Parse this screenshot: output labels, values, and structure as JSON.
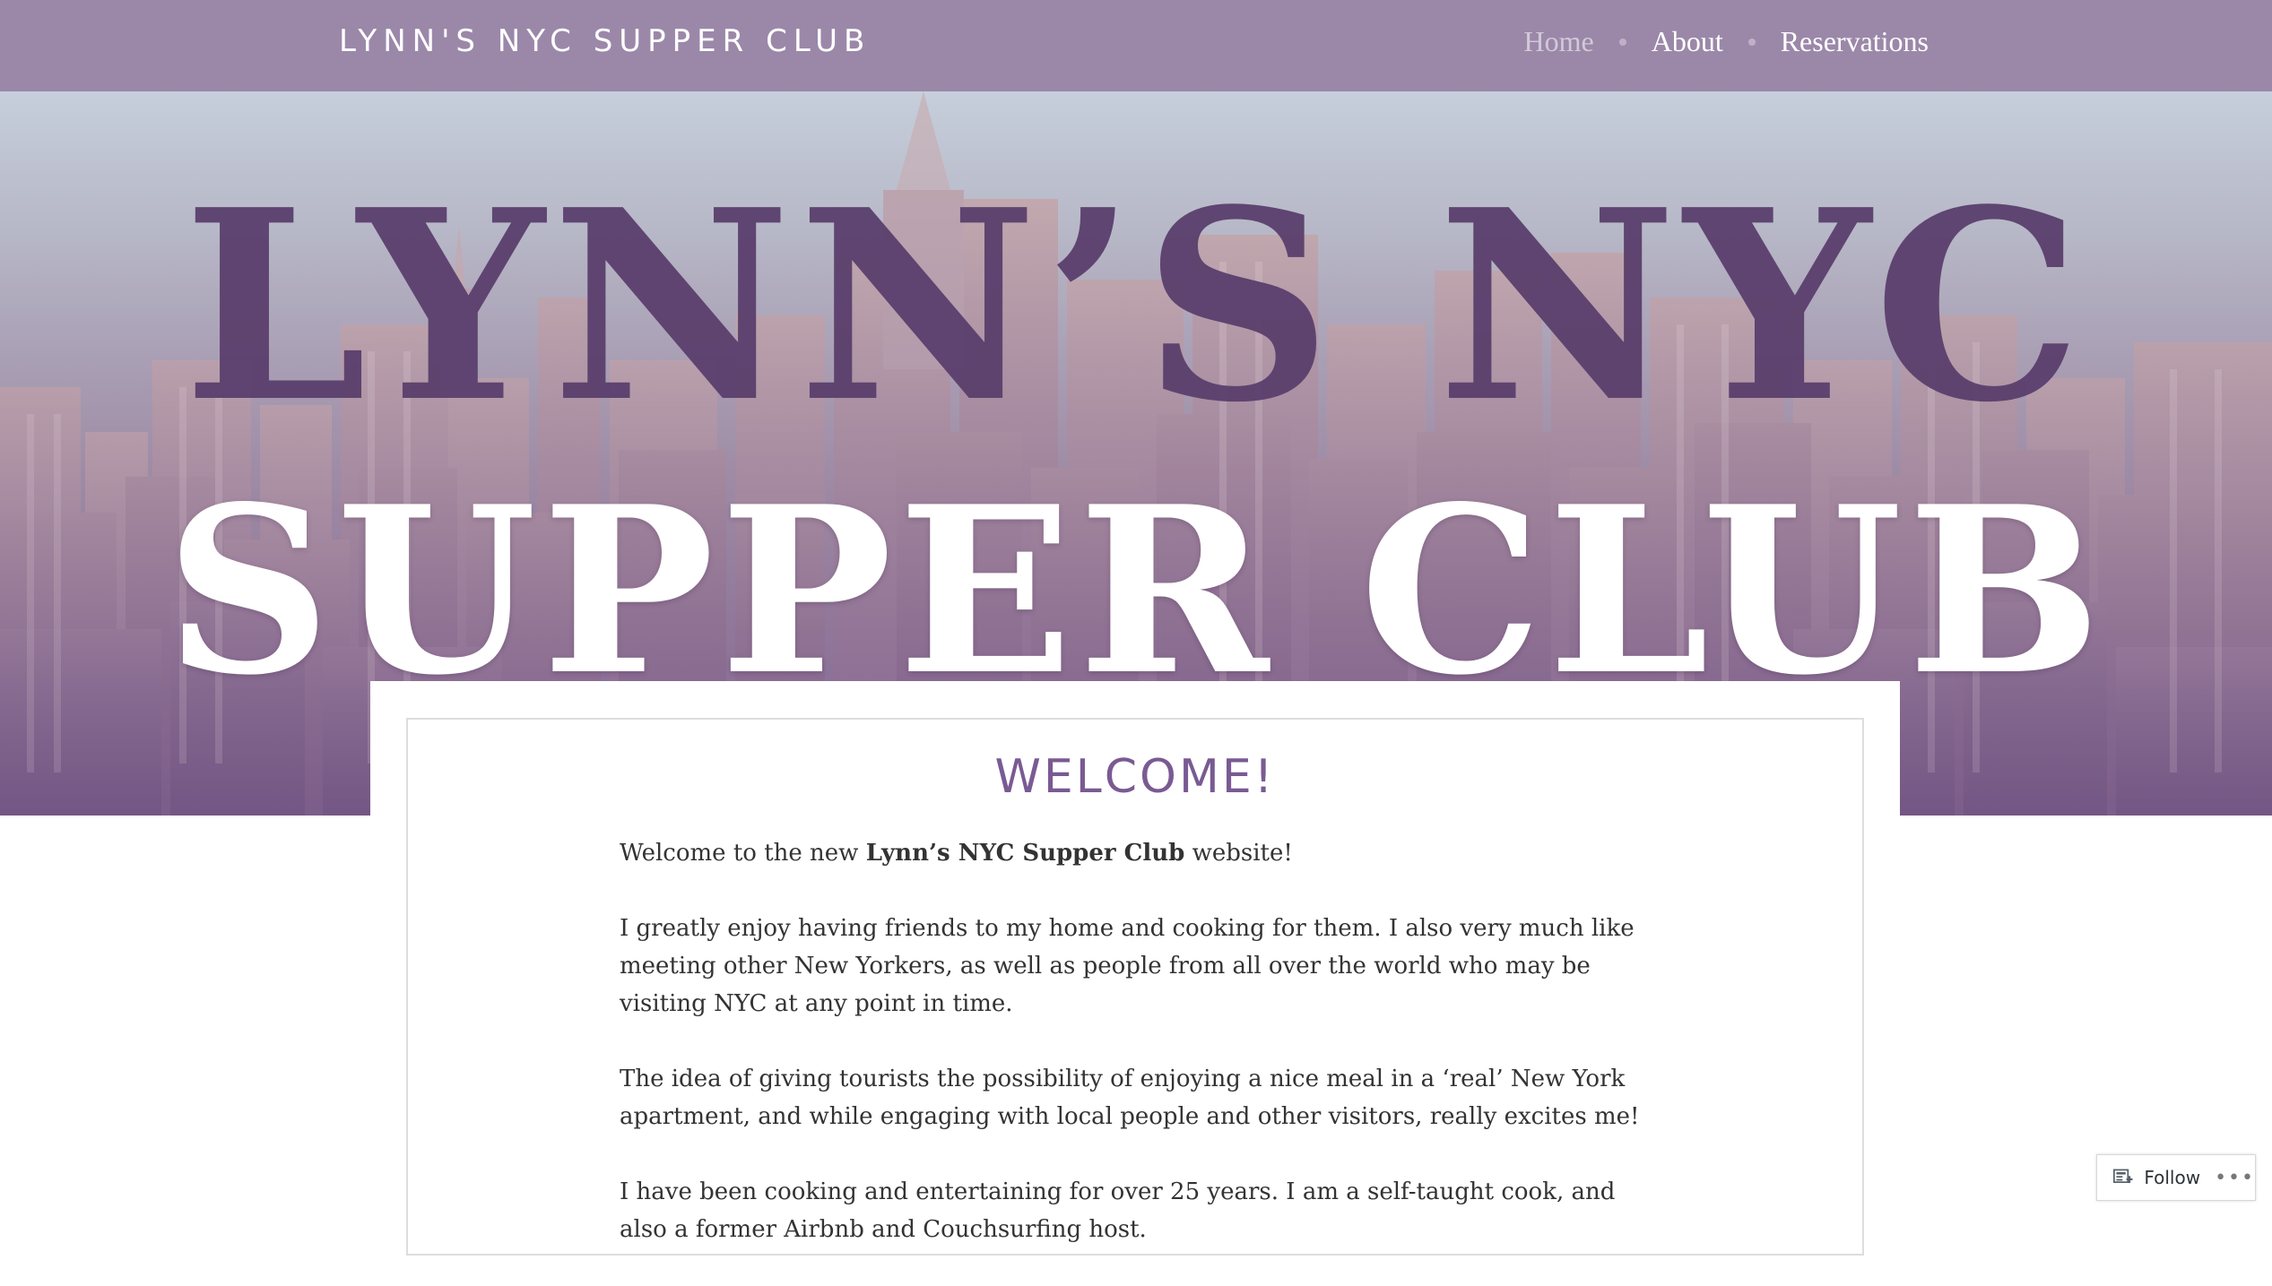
{
  "header": {
    "site_title": "LYNN'S NYC SUPPER CLUB",
    "nav": [
      {
        "label": "Home",
        "active": true
      },
      {
        "label": "About",
        "active": false
      },
      {
        "label": "Reservations",
        "active": false
      }
    ]
  },
  "hero": {
    "line1": "LYNN’S NYC",
    "line2": "SUPPER CLUB"
  },
  "post": {
    "title": "WELCOME!",
    "p1_pre": "Welcome to the new ",
    "p1_bold": "Lynn’s NYC Supper Club",
    "p1_post": " website!",
    "p2": "I greatly enjoy having friends to my home and cooking for them. I also very much like meeting other New Yorkers, as well as people from all over the world who may be visiting NYC at any point in time.",
    "p3": "The idea of giving tourists the possibility of enjoying a nice meal in a ‘real’ New York apartment, and while engaging with local people and other visitors, really excites me!",
    "p4": "I have been cooking and entertaining for over 25 years. I am a self-taught cook, and also a former Airbnb and Couchsurfing host."
  },
  "follow": {
    "label": "Follow",
    "more": "•••"
  },
  "colors": {
    "topbar": "#9b88a9",
    "title_purple": "#7a5a93",
    "hero_dark": "#5b3f6d"
  }
}
